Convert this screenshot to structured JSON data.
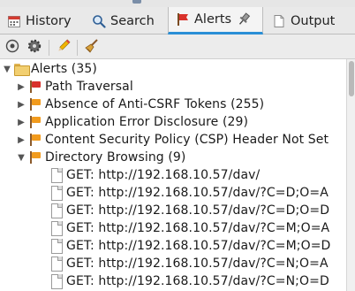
{
  "tabs": [
    {
      "label": "History",
      "icon": "calendar-icon"
    },
    {
      "label": "Search",
      "icon": "magnifier-icon"
    },
    {
      "label": "Alerts",
      "icon": "flag-icon",
      "active": true
    },
    {
      "label": "Output",
      "icon": "document-icon"
    }
  ],
  "toolbar": {
    "buttons": [
      "filter-icon",
      "gear-icon",
      "pencil-icon",
      "broom-icon"
    ]
  },
  "tree": {
    "root": {
      "label": "Alerts (35)",
      "expanded": true
    },
    "alerts": [
      {
        "label": "Path Traversal",
        "flag_color": "#d9312b"
      },
      {
        "label": "Absence of Anti-CSRF Tokens (255)",
        "flag_color": "#f29b1d"
      },
      {
        "label": "Application Error Disclosure (29)",
        "flag_color": "#f29b1d"
      },
      {
        "label": "Content Security Policy (CSP) Header Not Set",
        "flag_color": "#f29b1d"
      },
      {
        "label": "Directory Browsing (9)",
        "flag_color": "#f29b1d",
        "expanded": true
      }
    ],
    "children": [
      "GET: http://192.168.10.57/dav/",
      "GET: http://192.168.10.57/dav/?C=D;O=A",
      "GET: http://192.168.10.57/dav/?C=D;O=D",
      "GET: http://192.168.10.57/dav/?C=M;O=A",
      "GET: http://192.168.10.57/dav/?C=M;O=D",
      "GET: http://192.168.10.57/dav/?C=N;O=A",
      "GET: http://192.168.10.57/dav/?C=N;O=D"
    ]
  },
  "colors": {
    "accent": "#2a8fd6",
    "flag_high": "#d9312b",
    "flag_medium": "#f29b1d"
  }
}
